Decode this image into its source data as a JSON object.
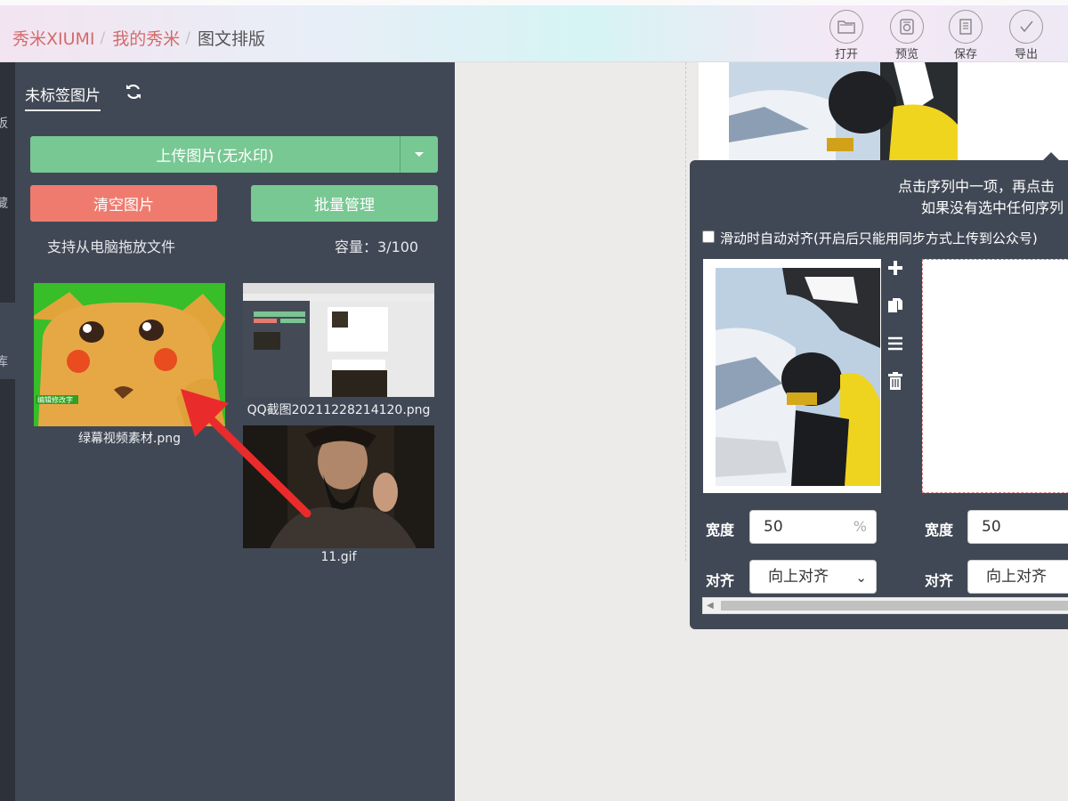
{
  "header": {
    "crumbs": [
      "秀米XIUMI",
      "我的秀米",
      "图文排版"
    ],
    "separator": "/",
    "tools": [
      {
        "label": "打开",
        "icon": "folder-icon"
      },
      {
        "label": "预览",
        "icon": "preview-icon"
      },
      {
        "label": "保存",
        "icon": "save-icon"
      },
      {
        "label": "导出",
        "icon": "export-check-icon"
      }
    ]
  },
  "sidebar": {
    "rail_chars": [
      "板",
      "藏",
      "库"
    ],
    "tab_label": "未标签图片",
    "upload_label": "上传图片(无水印)",
    "clear_label": "清空图片",
    "batch_label": "批量管理",
    "drag_hint": "支持从电脑拖放文件",
    "capacity": "容量：3/100",
    "images": [
      {
        "filename": "绿幕视频素材.png",
        "overlay_text": "编辑修改字"
      },
      {
        "filename": "QQ截图20211228214120.png"
      },
      {
        "filename": "11.gif"
      }
    ]
  },
  "popup": {
    "instruction_line1": "点击序列中一项，再点击",
    "instruction_line2": "如果没有选中任何序列",
    "auto_align_label": "滑动时自动对齐(开启后只能用同步方式上传到公众号)",
    "auto_align_checked": false,
    "width_label": "宽度",
    "width_value": "50",
    "width_unit": "%",
    "align_label": "对齐",
    "align_value": "向上对齐",
    "width_value_2": "50",
    "align_value_2": "向上对齐"
  },
  "colors": {
    "panel": "#414855",
    "green": "#78c893",
    "red": "#ef7b6f",
    "crumb": "#d46a6a"
  }
}
